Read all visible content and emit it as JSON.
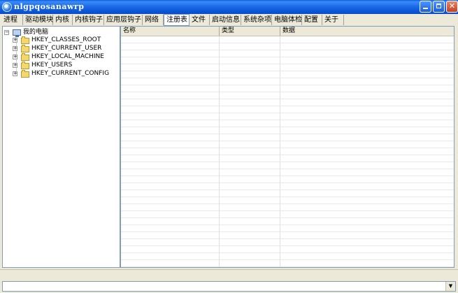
{
  "window": {
    "title": "nlgpqosanawrp"
  },
  "tabs": [
    {
      "label": "进程"
    },
    {
      "label": "驱动模块"
    },
    {
      "label": "内核"
    },
    {
      "label": "内核钩子"
    },
    {
      "label": "应用层钩子"
    },
    {
      "label": "网络"
    },
    {
      "label": "注册表",
      "active": true
    },
    {
      "label": "文件"
    },
    {
      "label": "启动信息"
    },
    {
      "label": "系统杂项"
    },
    {
      "label": "电脑体检"
    },
    {
      "label": "配置"
    },
    {
      "label": "关于"
    }
  ],
  "tree": {
    "root": {
      "label": "我的电脑",
      "icon": "computer-icon",
      "expanded": true
    },
    "children": [
      {
        "label": "HKEY_CLASSES_ROOT",
        "icon": "folder-icon"
      },
      {
        "label": "HKEY_CURRENT_USER",
        "icon": "folder-icon"
      },
      {
        "label": "HKEY_LOCAL_MACHINE",
        "icon": "folder-icon"
      },
      {
        "label": "HKEY_USERS",
        "icon": "folder-icon"
      },
      {
        "label": "HKEY_CURRENT_CONFIG",
        "icon": "folder-icon"
      }
    ]
  },
  "list": {
    "columns": [
      {
        "label": "名称"
      },
      {
        "label": "类型"
      },
      {
        "label": "数据"
      }
    ]
  },
  "colors": {
    "titlebar": "#0b55d6",
    "panel": "#ece9d8",
    "border": "#7f9db9"
  }
}
